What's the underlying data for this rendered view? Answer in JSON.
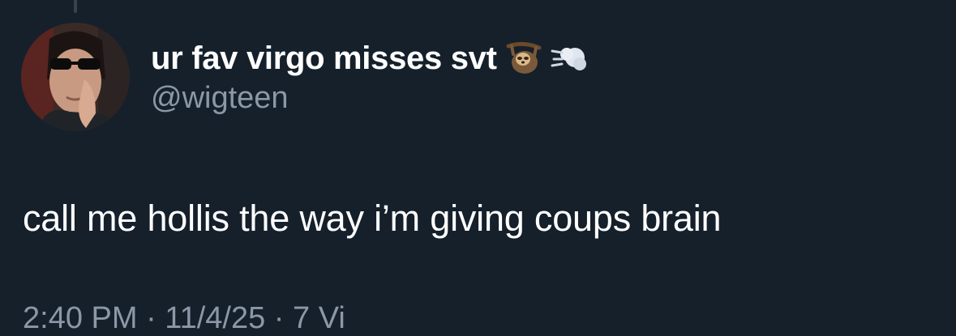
{
  "tweet": {
    "author": {
      "display_name": "ur fav virgo misses svt",
      "handle": "@wigteen",
      "name_emojis": [
        "sloth-emoji-icon",
        "dashing-away-emoji-icon"
      ]
    },
    "text": "call me hollis the way i’m giving coups brain",
    "meta_partial": "2:40 PM · 11/4/25 · 7 Vi"
  },
  "colors": {
    "background": "#15202b",
    "text_primary": "#ffffff",
    "text_secondary": "#8b98a5",
    "thread_line": "#38444d"
  }
}
